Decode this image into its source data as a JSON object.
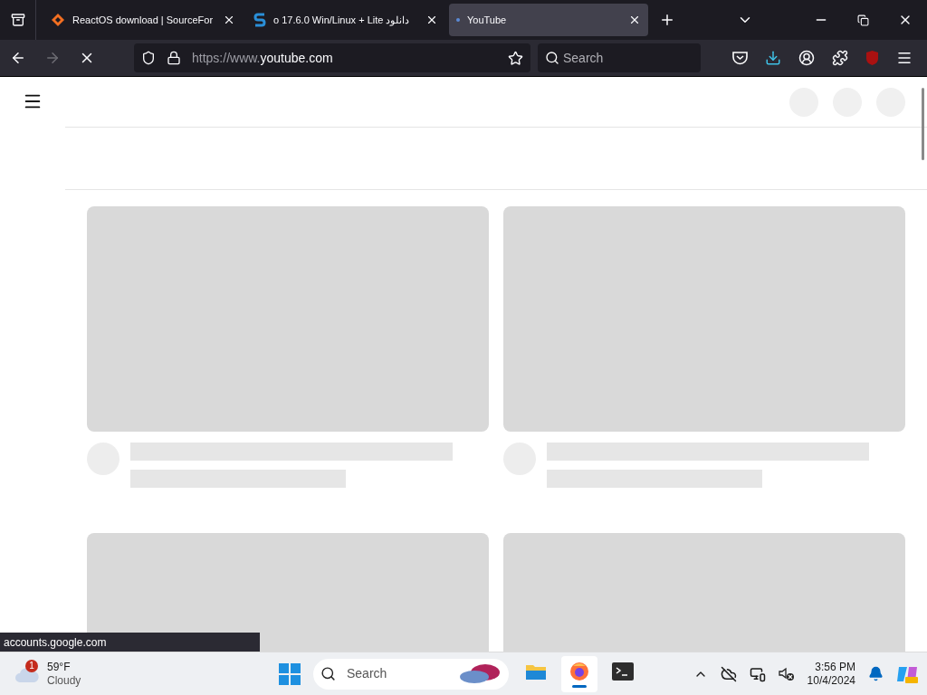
{
  "tabs": [
    {
      "title": "ReactOS download | SourceFor",
      "kind": "sourceforge",
      "selected": false
    },
    {
      "title": "o 17.6.0 Win/Linux + Lite دانلود",
      "kind": "soft",
      "selected": false
    },
    {
      "title": "YouTube",
      "kind": "loading",
      "selected": true
    }
  ],
  "toolbar": {
    "nav_buttons": [
      {
        "kind": "back",
        "disabled": false
      },
      {
        "kind": "forward",
        "disabled": true
      },
      {
        "kind": "stop",
        "disabled": false
      }
    ],
    "url_prefix": "https://www.",
    "url_domain": "youtube.com",
    "search_placeholder": "Search"
  },
  "page": {
    "cards": [
      {
        "kind": "skeleton"
      },
      {
        "kind": "skeleton"
      },
      {
        "kind": "thumbnail_only"
      },
      {
        "kind": "thumbnail_only"
      }
    ]
  },
  "status_url": "accounts.google.com",
  "taskbar": {
    "weather": {
      "temp": "59°F",
      "condition": "Cloudy",
      "badge": "1"
    },
    "search_placeholder": "Search",
    "apps": [
      {
        "kind": "files",
        "selected": false
      },
      {
        "kind": "firefox",
        "selected": true
      },
      {
        "kind": "terminal",
        "selected": false
      }
    ],
    "time": "3:56 PM",
    "date": "10/4/2024"
  }
}
